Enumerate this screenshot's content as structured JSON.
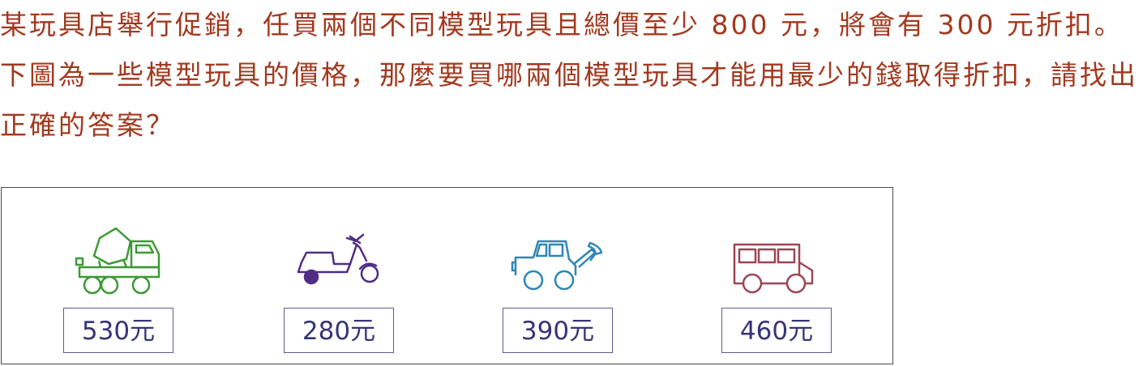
{
  "question": {
    "text": "某玩具店舉行促銷，任買兩個不同模型玩具且總價至少 800 元，將會有 300 元折扣。下圖為一些模型玩具的價格，那麼要買哪兩個模型玩具才能用最少的錢取得折扣，請找出正確的答案？"
  },
  "toys": [
    {
      "name": "cement-mixer-truck",
      "price": "530元",
      "color": "#3c9a35"
    },
    {
      "name": "scooter",
      "price": "280元",
      "color": "#4f2d86"
    },
    {
      "name": "bulldozer",
      "price": "390元",
      "color": "#2f86b5"
    },
    {
      "name": "bus",
      "price": "460元",
      "color": "#9c4653"
    }
  ]
}
